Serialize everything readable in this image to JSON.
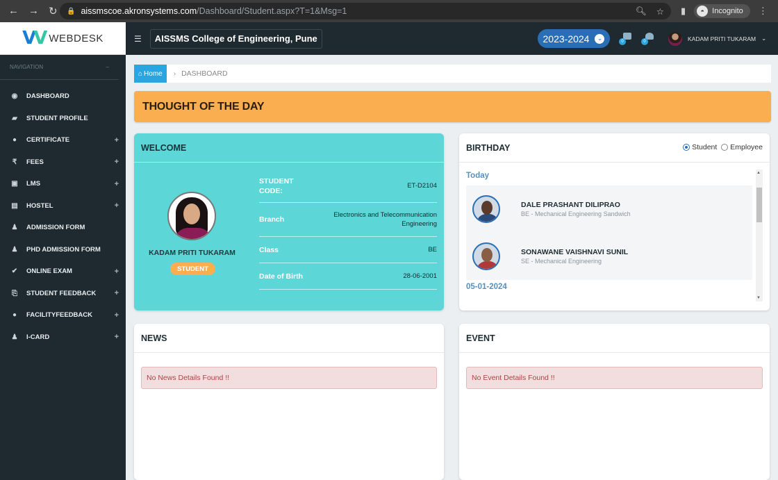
{
  "browser": {
    "url_domain": "aissmscoe.akronsystems.com",
    "url_path": "/Dashboard/Student.aspx?T=1&Msg=1",
    "incognito_label": "Incognito"
  },
  "brand": {
    "name": "WEBDESK"
  },
  "nav_header": "NAVIGATION",
  "menu": [
    {
      "icon": "tachometer-icon",
      "glyph": "◉",
      "label": "DASHBOARD",
      "expandable": false
    },
    {
      "icon": "graduation-cap-icon",
      "glyph": "▰",
      "label": "STUDENT PROFILE",
      "expandable": false
    },
    {
      "icon": "certificate-icon",
      "glyph": "●",
      "label": "CERTIFICATE",
      "expandable": true
    },
    {
      "icon": "rupee-icon",
      "glyph": "₹",
      "label": "FEES",
      "expandable": true
    },
    {
      "icon": "lms-icon",
      "glyph": "▣",
      "label": "LMS",
      "expandable": true
    },
    {
      "icon": "building-icon",
      "glyph": "▤",
      "label": "HOSTEL",
      "expandable": true
    },
    {
      "icon": "user-icon",
      "glyph": "♟",
      "label": "ADMISSION FORM",
      "expandable": false
    },
    {
      "icon": "user-icon",
      "glyph": "♟",
      "label": "PhD ADMISSION FORM",
      "expandable": false
    },
    {
      "icon": "check-icon",
      "glyph": "✔",
      "label": "ONLINE EXAM",
      "expandable": true
    },
    {
      "icon": "feedback-icon",
      "glyph": "⎘",
      "label": "STUDENT FEEDBACK",
      "expandable": true
    },
    {
      "icon": "comments-icon",
      "glyph": "●",
      "label": "FACILITYFEEDBACK",
      "expandable": true
    },
    {
      "icon": "user-icon",
      "glyph": "♟",
      "label": "I-CARD",
      "expandable": true
    }
  ],
  "topbar": {
    "college": "AISSMS College of Engineering, Pune",
    "year": "2023-2024",
    "notif1_count": "0",
    "notif2_count": "0",
    "user_name": "KADAM PRITI TUKARAM"
  },
  "breadcrumb": {
    "home": "Home",
    "current": "DASHBOARD"
  },
  "thought": {
    "title": "THOUGHT OF THE DAY"
  },
  "welcome": {
    "title": "WELCOME",
    "name": "KADAM PRITI TUKARAM",
    "role": "STUDENT",
    "fields": [
      {
        "key": "STUDENT CODE:",
        "value": "ET-D2104"
      },
      {
        "key": "Branch",
        "value": "Electronics and Telecommunication Engineering"
      },
      {
        "key": "Class",
        "value": "BE"
      },
      {
        "key": "Date of Birth",
        "value": "28-06-2001"
      }
    ]
  },
  "birthday": {
    "title": "BIRTHDAY",
    "radio_student": "Student",
    "radio_employee": "Employee",
    "selected": "Student",
    "sections": [
      {
        "date": "Today",
        "people": [
          {
            "name": "DALE PRASHANT DILIPRAO",
            "course": "BE - Mechanical Engineering Sandwich"
          },
          {
            "name": "SONAWANE VAISHNAVI SUNIL",
            "course": "SE - Mechanical Engineering"
          }
        ]
      },
      {
        "date": "05-01-2024",
        "people": []
      }
    ]
  },
  "news": {
    "title": "NEWS",
    "empty_message": "No News Details Found !!"
  },
  "event": {
    "title": "EVENT",
    "empty_message": "No Event Details Found !!"
  },
  "colors": {
    "accent": "#29a5e2",
    "welcome_bg": "#5cd6d6",
    "thought_bg": "#fbae4f",
    "sidebar": "#1e2a30"
  }
}
